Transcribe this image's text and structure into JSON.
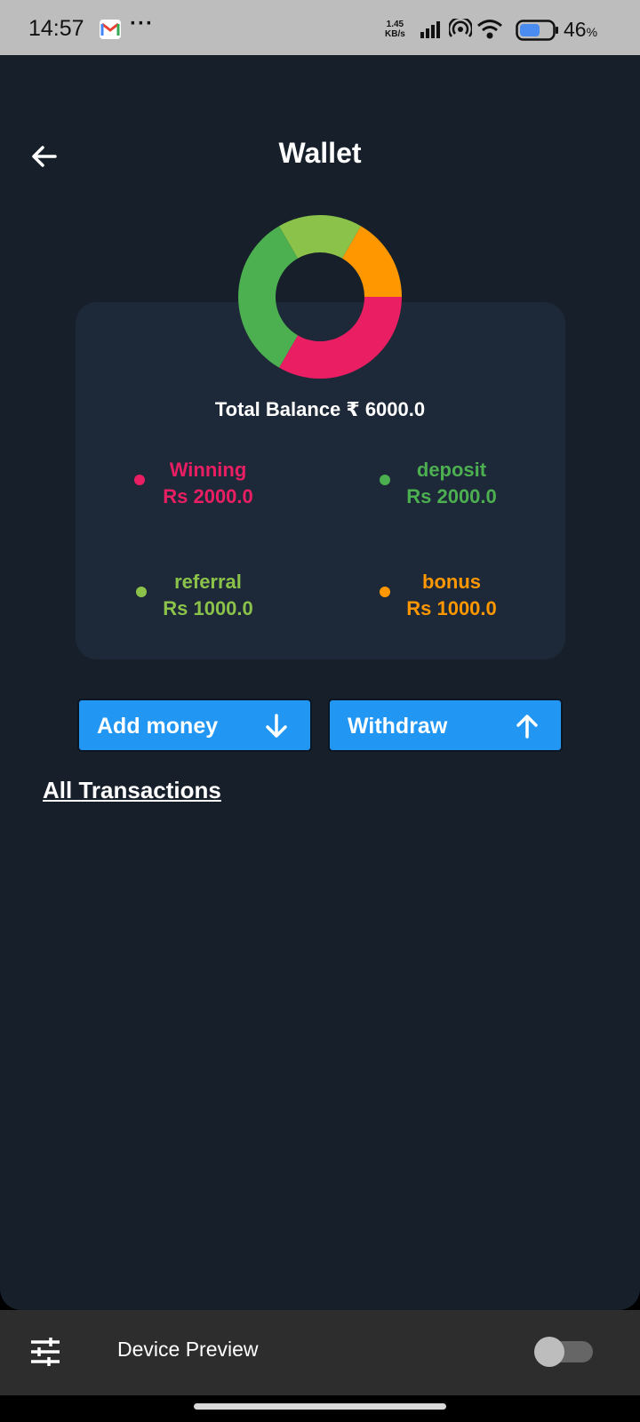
{
  "status_bar": {
    "time": "14:57",
    "net_speed_value": "1.45",
    "net_speed_unit": "KB/s",
    "battery_percent": "46",
    "battery_unit": "%"
  },
  "header": {
    "title": "Wallet"
  },
  "wallet": {
    "total_label": "Total Balance ₹ 6000.0",
    "breakdown": [
      {
        "name": "Winning",
        "amount": "Rs 2000.0",
        "color": "#e91e63"
      },
      {
        "name": "deposit",
        "amount": "Rs 2000.0",
        "color": "#4caf50"
      },
      {
        "name": "referral",
        "amount": "Rs 1000.0",
        "color": "#8bc34a"
      },
      {
        "name": "bonus",
        "amount": "Rs 1000.0",
        "color": "#ff9800"
      }
    ]
  },
  "actions": {
    "add_money": "Add money",
    "withdraw": "Withdraw"
  },
  "transactions": {
    "link": "All Transactions"
  },
  "device_preview": {
    "label": "Device Preview",
    "enabled": false
  },
  "chart_data": {
    "type": "pie",
    "categories": [
      "Winning",
      "deposit",
      "referral",
      "bonus"
    ],
    "values": [
      2000,
      2000,
      1000,
      1000
    ],
    "colors": [
      "#e91e63",
      "#4caf50",
      "#8bc34a",
      "#ff9800"
    ]
  }
}
